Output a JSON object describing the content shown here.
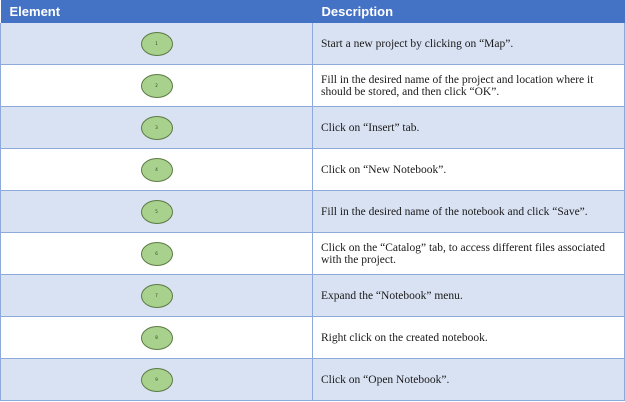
{
  "table": {
    "header": {
      "element": "Element",
      "description": "Description"
    },
    "rows": [
      {
        "badge": "1",
        "description": "Start a new project by clicking on “Map”."
      },
      {
        "badge": "2",
        "description": "Fill in the desired name of the project and location where it should be stored, and then click “OK”."
      },
      {
        "badge": "3",
        "description": "Click on “Insert” tab."
      },
      {
        "badge": "4",
        "description": "Click on “New Notebook”."
      },
      {
        "badge": "5",
        "description": "Fill in the desired name of the notebook and click “Save”."
      },
      {
        "badge": "6",
        "description": "Click on the “Catalog” tab, to access different files associated with the project."
      },
      {
        "badge": "7",
        "description": "Expand the “Notebook” menu."
      },
      {
        "badge": "8",
        "description": "Right click on the created notebook."
      },
      {
        "badge": "9",
        "description": "Click on “Open Notebook”."
      }
    ]
  },
  "colors": {
    "header_background": "#4472c4",
    "row_band": "#d9e2f3",
    "badge_fill": "#a9d18e",
    "badge_border": "#5b7a43"
  }
}
